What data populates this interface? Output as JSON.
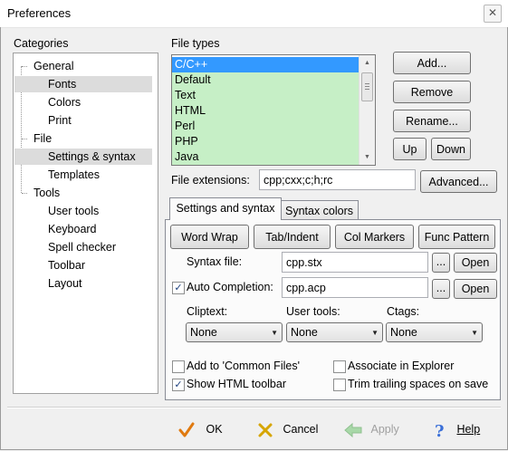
{
  "window": {
    "title": "Preferences",
    "close_glyph": "✕"
  },
  "categories": {
    "label": "Categories",
    "items": [
      {
        "label": "General",
        "selected": false
      },
      {
        "label": "Fonts",
        "selected": true
      },
      {
        "label": "Colors",
        "selected": false
      },
      {
        "label": "Print",
        "selected": false
      },
      {
        "label": "File",
        "selected": false
      },
      {
        "label": "Settings & syntax",
        "selected": true
      },
      {
        "label": "Templates",
        "selected": false
      },
      {
        "label": "Tools",
        "selected": false
      },
      {
        "label": "User tools",
        "selected": false
      },
      {
        "label": "Keyboard",
        "selected": false
      },
      {
        "label": "Spell checker",
        "selected": false
      },
      {
        "label": "Toolbar",
        "selected": false
      },
      {
        "label": "Layout",
        "selected": false
      }
    ]
  },
  "file_types": {
    "label": "File types",
    "items": [
      "C/C++",
      "Default",
      "Text",
      "HTML",
      "Perl",
      "PHP",
      "Java"
    ],
    "selected": "C/C++",
    "highlight_color": "#c6efc6",
    "selected_color": "#3399ff"
  },
  "type_buttons": {
    "add": "Add...",
    "remove": "Remove",
    "rename": "Rename...",
    "up": "Up",
    "down": "Down"
  },
  "file_extensions": {
    "label": "File extensions:",
    "value": "cpp;cxx;c;h;rc",
    "advanced": "Advanced..."
  },
  "tabs": {
    "settings": "Settings and syntax",
    "colors": "Syntax colors",
    "active": "settings"
  },
  "toggles": {
    "word_wrap": "Word Wrap",
    "tab_indent": "Tab/Indent",
    "col_markers": "Col Markers",
    "func_pattern": "Func Pattern"
  },
  "syntax_file": {
    "label": "Syntax file:",
    "value": "cpp.stx",
    "browse": "...",
    "open": "Open"
  },
  "auto_completion": {
    "label": "Auto Completion:",
    "checked": true,
    "value": "cpp.acp",
    "browse": "...",
    "open": "Open"
  },
  "dropdowns": {
    "cliptext": {
      "label": "Cliptext:",
      "value": "None"
    },
    "user_tools": {
      "label": "User tools:",
      "value": "None"
    },
    "ctags": {
      "label": "Ctags:",
      "value": "None"
    }
  },
  "options": {
    "common_files": {
      "label": "Add to 'Common Files'",
      "checked": false
    },
    "associate": {
      "label": "Associate in Explorer",
      "checked": false
    },
    "html_toolbar": {
      "label": "Show HTML toolbar",
      "checked": true
    },
    "trim_spaces": {
      "label": "Trim trailing spaces on save",
      "checked": false
    }
  },
  "footer": {
    "ok": "OK",
    "cancel": "Cancel",
    "apply": "Apply",
    "help": "Help"
  },
  "colors": {
    "ok_icon": "#e07a10",
    "cancel_icon": "#d6a500",
    "apply_icon": "#a8d8a8",
    "help_icon": "#3a6fd8"
  }
}
